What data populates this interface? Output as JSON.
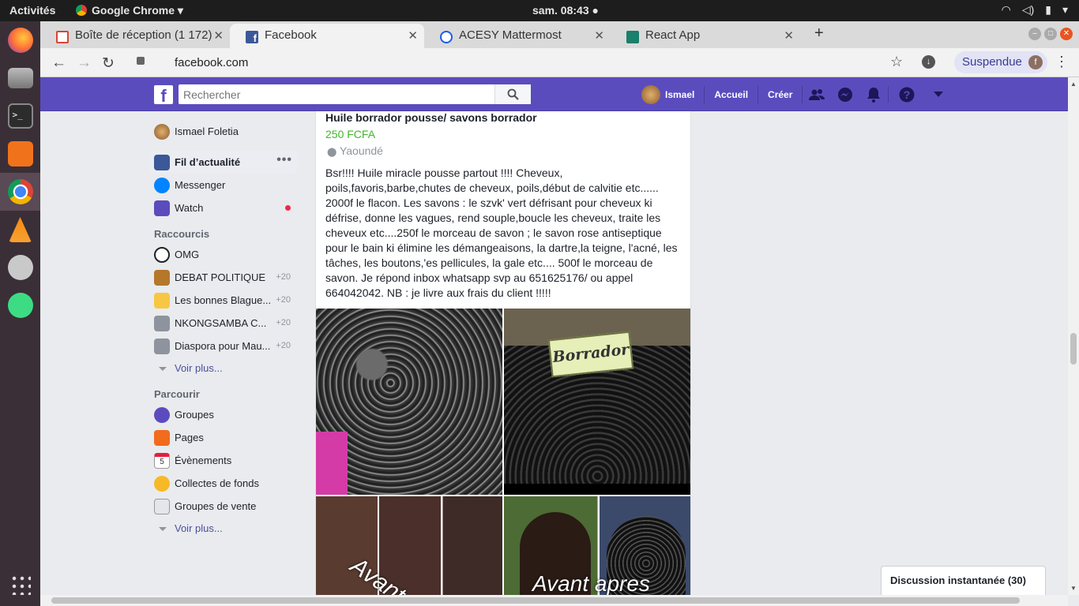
{
  "system": {
    "activities": "Activités",
    "app_name": "Google Chrome",
    "clock": "sam. 08:43"
  },
  "tabs": [
    {
      "title": "Boîte de réception (1 172)",
      "icon": "gmail-icon",
      "color": "#d44638"
    },
    {
      "title": "Facebook",
      "icon": "facebook-icon",
      "color": "#3b5998"
    },
    {
      "title": "ACESY Mattermost",
      "icon": "mattermost-icon",
      "color": "#1e5be6"
    },
    {
      "title": "React App",
      "icon": "react-icon",
      "color": "#1a7f6b"
    }
  ],
  "address_bar": {
    "url": "facebook.com",
    "profile_label": "Suspendue",
    "profile_initial": "f"
  },
  "fb_header": {
    "search_placeholder": "Rechercher",
    "user_name": "Ismael",
    "home_label": "Accueil",
    "create_label": "Créer"
  },
  "sidebar": {
    "profile": "Ismael Foletia",
    "main": [
      {
        "label": "Fil d’actualité",
        "icon": "news-feed-icon",
        "selected": true
      },
      {
        "label": "Messenger",
        "icon": "messenger-icon"
      },
      {
        "label": "Watch",
        "icon": "watch-icon",
        "notify": true
      }
    ],
    "shortcuts_heading": "Raccourcis",
    "shortcuts": [
      {
        "label": "OMG",
        "icon": "omg-icon",
        "count": ""
      },
      {
        "label": "DEBAT POLITIQUE",
        "icon": "gavel-icon",
        "count": "+20"
      },
      {
        "label": "Les bonnes Blague...",
        "icon": "masks-icon",
        "count": "+20"
      },
      {
        "label": "NKONGSAMBA C...",
        "icon": "group-icon",
        "count": "+20"
      },
      {
        "label": "Diaspora pour Mau...",
        "icon": "group-icon",
        "count": "+20"
      }
    ],
    "see_more": "Voir plus...",
    "explore_heading": "Parcourir",
    "explore": [
      {
        "label": "Groupes",
        "icon": "groups-icon"
      },
      {
        "label": "Pages",
        "icon": "pages-icon"
      },
      {
        "label": "Évènements",
        "icon": "events-icon"
      },
      {
        "label": "Collectes de fonds",
        "icon": "fundraiser-icon"
      },
      {
        "label": "Groupes de vente",
        "icon": "sale-groups-icon"
      }
    ],
    "see_more_2": "Voir plus...",
    "calendar_day": "5"
  },
  "post": {
    "title": "Huile borrador pousse/ savons borrador",
    "price": "250 FCFA",
    "location": "Yaoundé",
    "description": "Bsr!!!! Huile miracle pousse partout !!!! Cheveux, poils,favoris,barbe,chutes de cheveux, poils,début de calvitie etc...... 2000f le flacon. Les savons : le szvk' vert défrisant pour cheveux ki défrise, donne les vagues, rend souple,boucle les cheveux, traite les cheveux etc....250f le morceau de savon ; le savon rose antiseptique pour le bain ki élimine les démangeaisons, la dartre,la teigne, l'acné, les tâches, les boutons,'es pellicules, la gale etc.... 500f le morceau de savon. Je répond inbox whatsapp svp au 651625176/ ou appel 664042042. NB : je livre aux frais du client !!!!!",
    "image_texts": {
      "soap_brand": "Borrador",
      "before": "Avant",
      "before_after": "Avant apres"
    }
  },
  "chat": {
    "label": "Discussion instantanée (30)"
  }
}
